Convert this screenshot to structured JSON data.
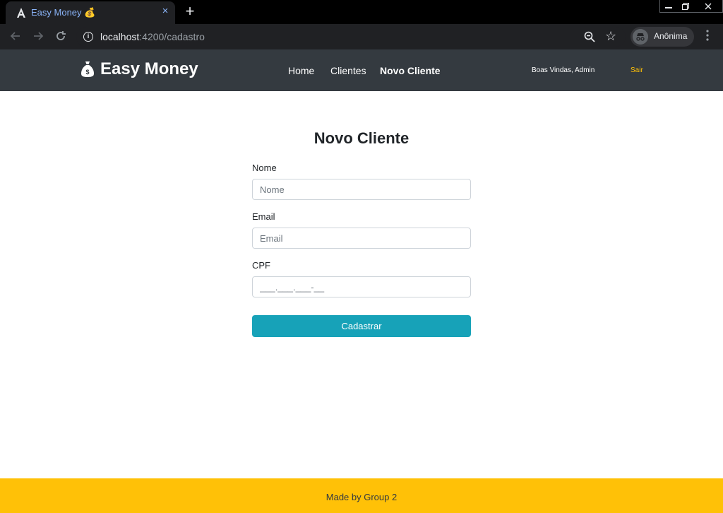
{
  "browser": {
    "tab_title": "Easy Money 💰",
    "tab_close": "×",
    "new_tab": "+",
    "url_host": "localhost",
    "url_rest": ":4200/cadastro",
    "profile_label": "Anônima",
    "icons": [
      "angular-logo-icon",
      "back-icon",
      "forward-icon",
      "reload-icon",
      "info-icon",
      "zoom-out-icon",
      "star-icon",
      "incognito-icon",
      "menu-icon"
    ]
  },
  "navbar": {
    "brand": "Easy Money",
    "links": [
      "Home",
      "Clientes",
      "Novo Cliente"
    ],
    "active_link": "Novo Cliente",
    "welcome": "Boas Vindas, Admin",
    "logout": "Sair"
  },
  "form": {
    "title": "Novo Cliente",
    "nome": {
      "label": "Nome",
      "placeholder": "Nome",
      "value": ""
    },
    "email": {
      "label": "Email",
      "placeholder": "Email",
      "value": ""
    },
    "cpf": {
      "label": "CPF",
      "placeholder": "___.___.___-__",
      "value": ""
    },
    "submit": "Cadastrar"
  },
  "footer": {
    "text": "Made by Group 2"
  },
  "colors": {
    "navbar_bg": "#343a40",
    "accent_yellow": "#ffc107",
    "button_teal": "#17a2b8"
  }
}
